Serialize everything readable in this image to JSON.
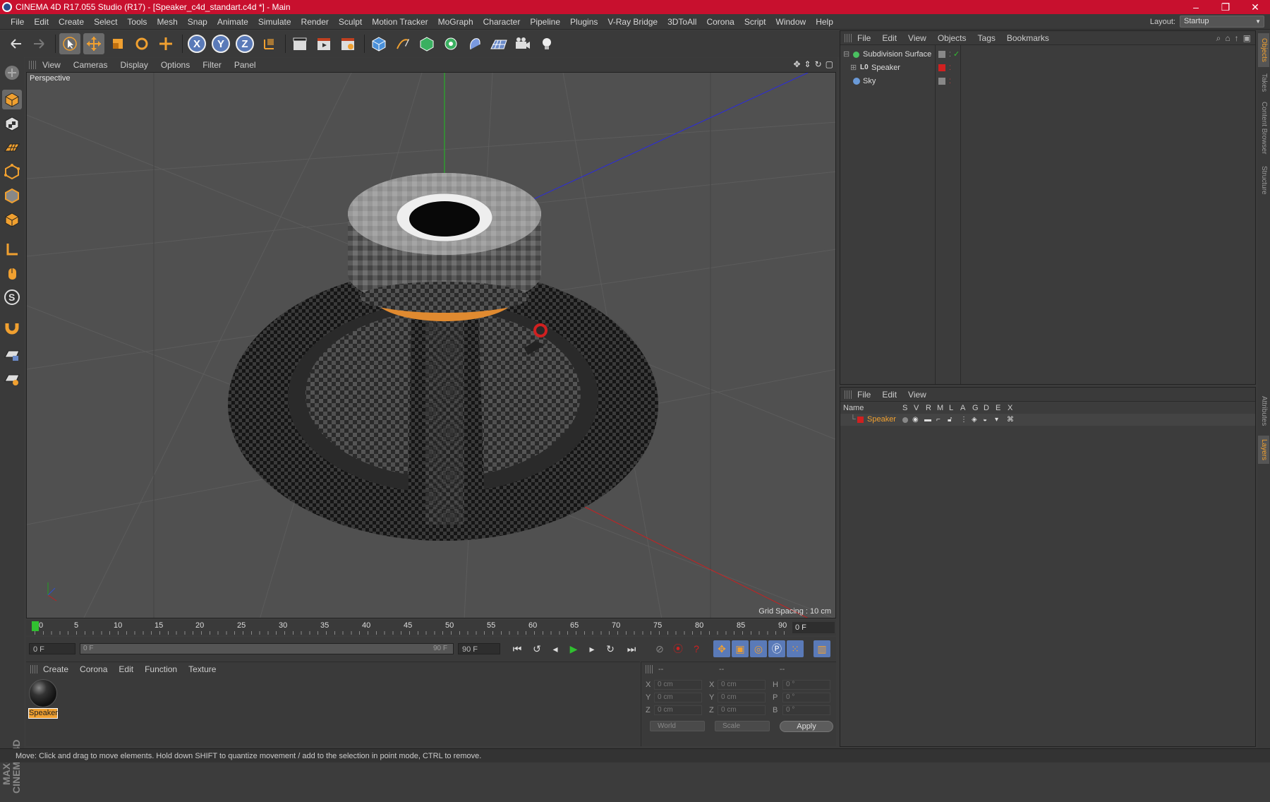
{
  "window": {
    "title": "CINEMA 4D R17.055 Studio (R17) - [Speaker_c4d_standart.c4d *] - Main",
    "controls": [
      "–",
      "❐",
      "✕"
    ]
  },
  "menubar": {
    "items": [
      "File",
      "Edit",
      "Create",
      "Select",
      "Tools",
      "Mesh",
      "Snap",
      "Animate",
      "Simulate",
      "Render",
      "Sculpt",
      "Motion Tracker",
      "MoGraph",
      "Character",
      "Pipeline",
      "Plugins",
      "V-Ray Bridge",
      "3DToAll",
      "Corona",
      "Script",
      "Window",
      "Help"
    ],
    "layout_label": "Layout:",
    "layout_value": "Startup"
  },
  "toolbar": {
    "axis_x": "X",
    "axis_y": "Y",
    "axis_z": "Z"
  },
  "viewport": {
    "menu": [
      "View",
      "Cameras",
      "Display",
      "Options",
      "Filter",
      "Panel"
    ],
    "label": "Perspective",
    "grid_spacing": "Grid Spacing : 10 cm"
  },
  "timeline": {
    "ticks": [
      "0",
      "5",
      "10",
      "15",
      "20",
      "25",
      "30",
      "35",
      "40",
      "45",
      "50",
      "55",
      "60",
      "65",
      "70",
      "75",
      "80",
      "85",
      "90"
    ],
    "current_frame": "0 F",
    "start_field": "0 F",
    "range_start": "0 F",
    "range_end": "90 F",
    "end_field": "90 F"
  },
  "material_panel": {
    "menu": [
      "Create",
      "Corona",
      "Edit",
      "Function",
      "Texture"
    ],
    "material_name": "Speaker"
  },
  "coord_panel": {
    "headers": [
      "--",
      "--",
      "--"
    ],
    "rows": [
      {
        "a": "X",
        "av": "0 cm",
        "b": "X",
        "bv": "0 cm",
        "c": "H",
        "cv": "0 °"
      },
      {
        "a": "Y",
        "av": "0 cm",
        "b": "Y",
        "bv": "0 cm",
        "c": "P",
        "cv": "0 °"
      },
      {
        "a": "Z",
        "av": "0 cm",
        "b": "Z",
        "bv": "0 cm",
        "c": "B",
        "cv": "0 °"
      }
    ],
    "world": "World",
    "scale": "Scale",
    "apply": "Apply"
  },
  "object_manager": {
    "menu": [
      "File",
      "Edit",
      "View",
      "Objects",
      "Tags",
      "Bookmarks"
    ],
    "objects": [
      {
        "name": "Subdivision Surface",
        "icon_color": "#4ac060"
      },
      {
        "name": "Speaker",
        "icon_color": "#cccccc"
      },
      {
        "name": "Sky",
        "icon_color": "#6a9ad8"
      }
    ]
  },
  "layer_manager": {
    "menu": [
      "File",
      "Edit",
      "View"
    ],
    "columns": [
      "Name",
      "S",
      "V",
      "R",
      "M",
      "L",
      "A",
      "G",
      "D",
      "E",
      "X"
    ],
    "layers": [
      {
        "name": "Speaker",
        "color": "#d02020"
      }
    ]
  },
  "right_tabs": [
    "Objects",
    "Takes",
    "Content Browser",
    "Structure",
    "Attributes",
    "Layers"
  ],
  "status": "Move: Click and drag to move elements. Hold down SHIFT to quantize movement / add to the selection in point mode, CTRL to remove.",
  "colors": {
    "accent": "#f0a030",
    "title_bar": "#c8102e",
    "selection_blue": "#5a7ab8"
  }
}
